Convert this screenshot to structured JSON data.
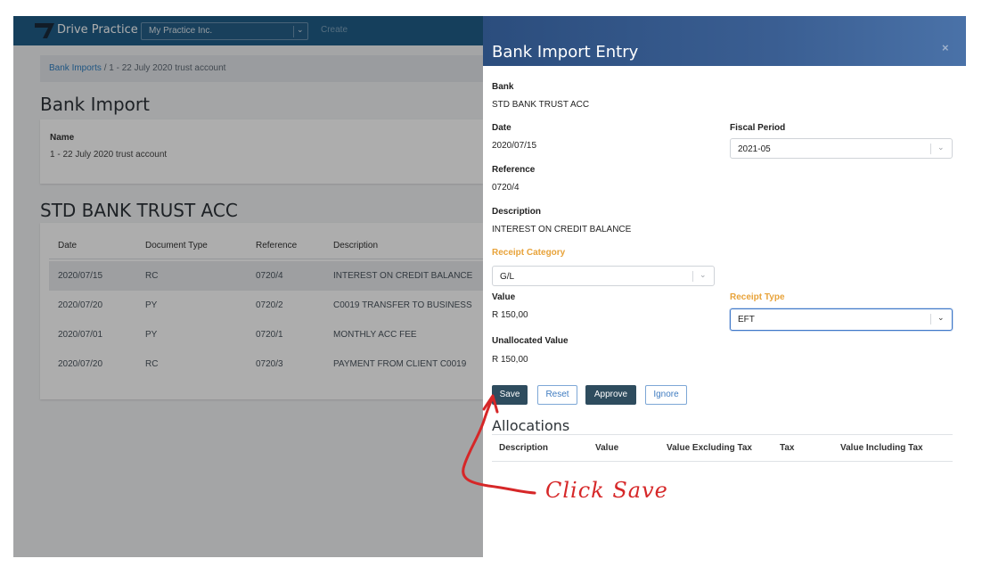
{
  "topbar": {
    "brand": "Drive Practice",
    "practice_value": "My Practice Inc.",
    "create_label": "Create"
  },
  "breadcrumb": {
    "link": "Bank Imports",
    "separator": "/",
    "current": "1 - 22 July 2020 trust account"
  },
  "page": {
    "title": "Bank Import",
    "name_label": "Name",
    "name_value": "1 - 22 July 2020 trust account",
    "account_title": "STD BANK TRUST ACC"
  },
  "table": {
    "headers": [
      "Date",
      "Document Type",
      "Reference",
      "Description"
    ],
    "rows": [
      {
        "date": "2020/07/15",
        "doc_type": "RC",
        "reference": "0720/4",
        "description": "INTEREST ON CREDIT BALANCE"
      },
      {
        "date": "2020/07/20",
        "doc_type": "PY",
        "reference": "0720/2",
        "description": "C0019 TRANSFER TO BUSINESS"
      },
      {
        "date": "2020/07/01",
        "doc_type": "PY",
        "reference": "0720/1",
        "description": "MONTHLY ACC FEE"
      },
      {
        "date": "2020/07/20",
        "doc_type": "RC",
        "reference": "0720/3",
        "description": "PAYMENT FROM CLIENT C0019"
      }
    ]
  },
  "modal": {
    "title": "Bank Import Entry",
    "close": "×",
    "bank_label": "Bank",
    "bank_value": "STD BANK TRUST ACC",
    "date_label": "Date",
    "date_value": "2020/07/15",
    "fiscal_label": "Fiscal Period",
    "fiscal_value": "2021-05",
    "reference_label": "Reference",
    "reference_value": "0720/4",
    "description_label": "Description",
    "description_value": "INTEREST ON CREDIT BALANCE",
    "receipt_category_label": "Receipt Category",
    "receipt_category_value": "G/L",
    "value_label": "Value",
    "value_value": "R 150,00",
    "receipt_type_label": "Receipt Type",
    "receipt_type_value": "EFT",
    "unallocated_label": "Unallocated Value",
    "unallocated_value": "R 150,00",
    "buttons": {
      "save": "Save",
      "reset": "Reset",
      "approve": "Approve",
      "ignore": "Ignore"
    },
    "allocations_title": "Allocations",
    "allocations_headers": [
      "Description",
      "Value",
      "Value Excluding Tax",
      "Tax",
      "Value Including Tax"
    ]
  },
  "annotation": {
    "text": "Click Save"
  },
  "colors": {
    "topbar": "#1f5d88",
    "modal_header": "#2b4d7d",
    "accent_label": "#e8a33a",
    "dark_button": "#2e4c5e",
    "annotation": "#d62728"
  }
}
